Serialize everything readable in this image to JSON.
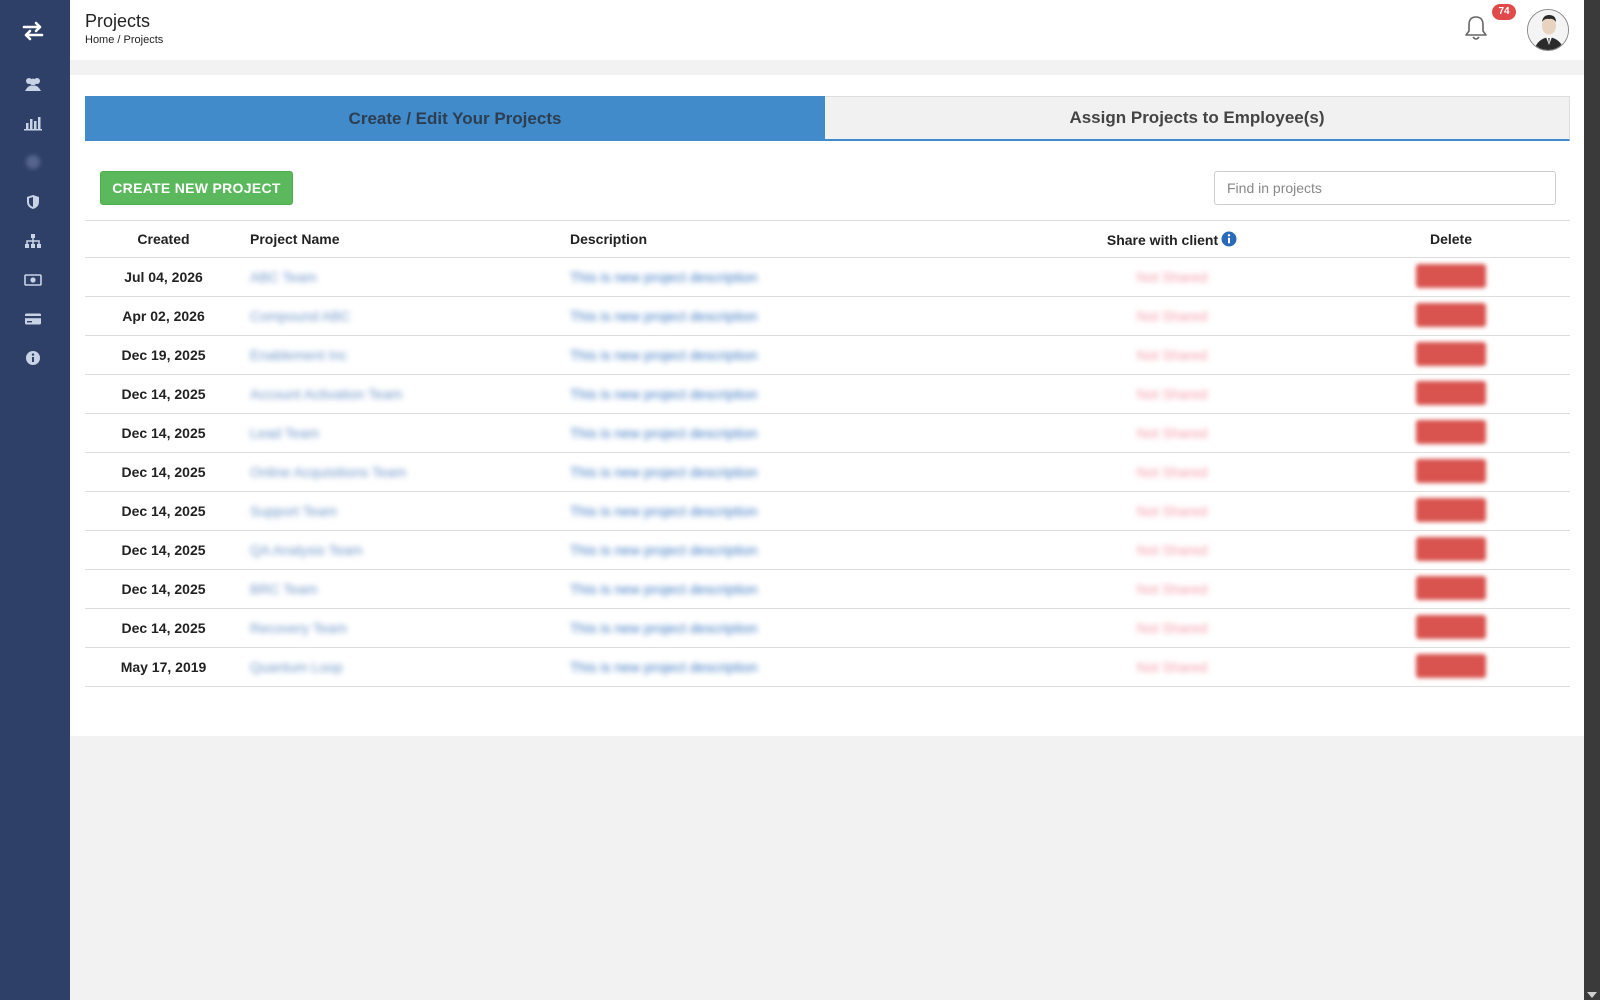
{
  "header": {
    "title": "Projects",
    "breadcrumb": {
      "home": "Home",
      "separator": "/",
      "current": "Projects"
    },
    "notification_count": "74"
  },
  "sidebar": {
    "items": [
      {
        "icon": "users-icon"
      },
      {
        "icon": "bar-chart-icon"
      },
      {
        "icon": "blurred-icon"
      },
      {
        "icon": "shield-icon"
      },
      {
        "icon": "org-chart-icon"
      },
      {
        "icon": "money-icon"
      },
      {
        "icon": "credit-card-icon"
      },
      {
        "icon": "info-icon"
      }
    ]
  },
  "tabs": [
    {
      "label": "Create / Edit Your Projects",
      "active": true
    },
    {
      "label": "Assign Projects to Employee(s)",
      "active": false
    }
  ],
  "toolbar": {
    "create_label": "CREATE NEW PROJECT",
    "search_placeholder": "Find in projects"
  },
  "table": {
    "headers": {
      "created": "Created",
      "name": "Project Name",
      "description": "Description",
      "share": "Share with client",
      "delete": "Delete"
    },
    "rows": [
      {
        "created": "Jul 04, 2026",
        "name": "ABC Team",
        "description": "This is new project description",
        "share": "Not Shared"
      },
      {
        "created": "Apr 02, 2026",
        "name": "Compound ABC",
        "description": "This is new project description",
        "share": "Not Shared"
      },
      {
        "created": "Dec 19, 2025",
        "name": "Enablement Inc",
        "description": "This is new project description",
        "share": "Not Shared"
      },
      {
        "created": "Dec 14, 2025",
        "name": "Account Activation Team",
        "description": "This is new project description",
        "share": "Not Shared"
      },
      {
        "created": "Dec 14, 2025",
        "name": "Lead Team",
        "description": "This is new project description",
        "share": "Not Shared"
      },
      {
        "created": "Dec 14, 2025",
        "name": "Online Acquisitions Team",
        "description": "This is new project description",
        "share": "Not Shared"
      },
      {
        "created": "Dec 14, 2025",
        "name": "Support Team",
        "description": "This is new project description",
        "share": "Not Shared"
      },
      {
        "created": "Dec 14, 2025",
        "name": "QA Analysis Team",
        "description": "This is new project description",
        "share": "Not Shared"
      },
      {
        "created": "Dec 14, 2025",
        "name": "BRC Team",
        "description": "This is new project description",
        "share": "Not Shared"
      },
      {
        "created": "Dec 14, 2025",
        "name": "Recovery Team",
        "description": "This is new project description",
        "share": "Not Shared"
      },
      {
        "created": "May 17, 2019",
        "name": "Quantum Loop",
        "description": "This is new project description",
        "share": "Not Shared"
      }
    ]
  },
  "colors": {
    "sidebar": "#2f4068",
    "tab_active": "#428bca",
    "create_button": "#5cb85c",
    "delete_button": "#d9534f",
    "badge": "#e04a4a"
  }
}
